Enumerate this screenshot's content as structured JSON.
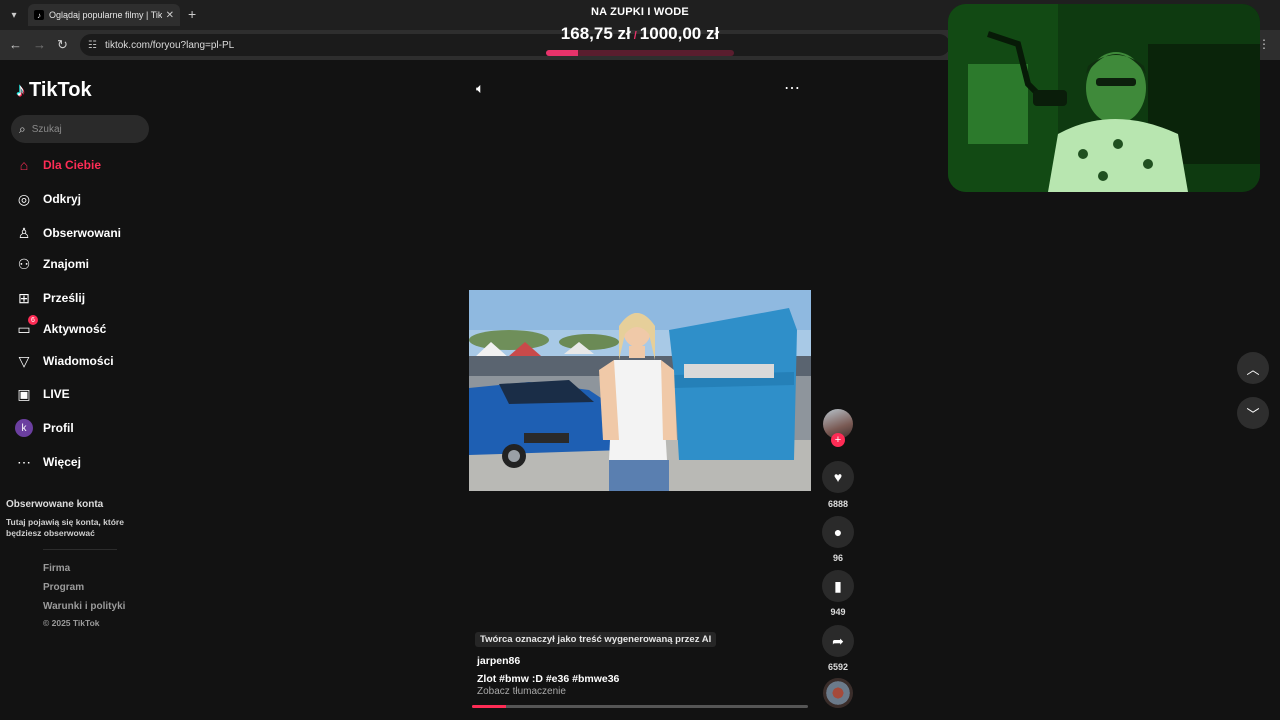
{
  "browser": {
    "tab_title": "Oglądaj popularne filmy | TikTok",
    "tab_close": "✕",
    "new_tab": "+",
    "url": "tiktok.com/foryou?lang=pl-PL"
  },
  "donation": {
    "goal_label": "NA ZUPKI I WODE",
    "current": "168,75 zł",
    "separator": "/",
    "target": "1000,00 zł",
    "progress": 0.169
  },
  "sidebar": {
    "logo": "TikTok",
    "search_placeholder": "Szukaj",
    "items": [
      {
        "label": "Dla Ciebie",
        "icon": "home-icon",
        "active": true
      },
      {
        "label": "Odkryj",
        "icon": "compass-icon"
      },
      {
        "label": "Obserwowani",
        "icon": "following-icon"
      },
      {
        "label": "Znajomi",
        "icon": "friends-icon"
      },
      {
        "label": "Prześlij",
        "icon": "upload-icon"
      },
      {
        "label": "Aktywność",
        "icon": "activity-icon",
        "badge": "6"
      },
      {
        "label": "Wiadomości",
        "icon": "messages-icon"
      },
      {
        "label": "LIVE",
        "icon": "live-icon"
      },
      {
        "label": "Profil",
        "icon": "profile-avatar",
        "avatar_letter": "k"
      },
      {
        "label": "Więcej",
        "icon": "more-icon"
      }
    ],
    "followed_title": "Obserwowane konta",
    "followed_desc": "Tutaj pojawią się konta, które będziesz obserwować",
    "footer_links": [
      "Firma",
      "Program",
      "Warunki i polityki"
    ],
    "copyright": "© 2025 TikTok"
  },
  "video": {
    "ai_label": "Twórca oznaczył jako treść wygenerowaną przez AI",
    "author": "jarpen86",
    "caption": "Zlot #bmw  :D #e36  #bmwe36",
    "translate": "Zobacz tłumaczenie",
    "progress": 0.1
  },
  "actions": {
    "likes": "6888",
    "comments": "96",
    "saves": "949",
    "shares": "6592"
  },
  "colors": {
    "accent": "#fe2c55",
    "background": "#121212"
  }
}
